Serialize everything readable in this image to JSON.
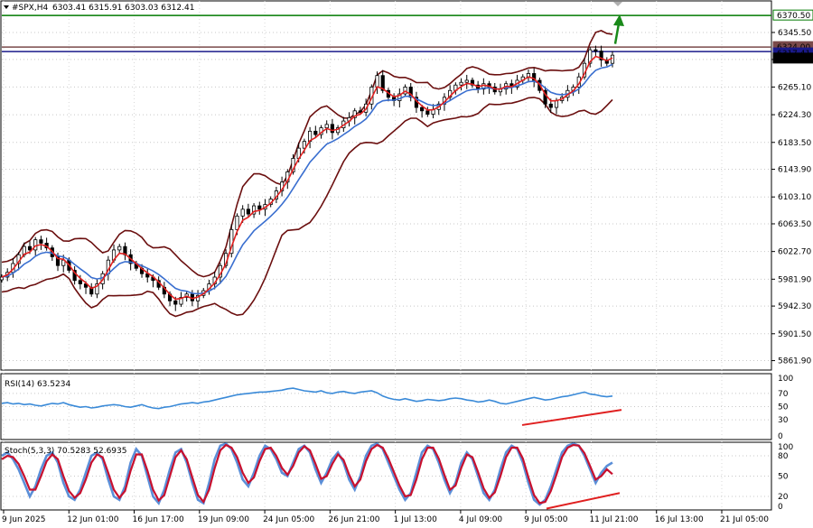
{
  "header": {
    "symbol": "#SPX,H4",
    "ohlc": "6303.41 6315.91 6303.03 6312.41"
  },
  "chart_data": [
    {
      "type": "candlestick",
      "name": "price",
      "ylim": [
        5848,
        6392
      ],
      "y_ticks": [
        "6345.50",
        "6305.70",
        "6265.10",
        "6224.30",
        "6183.50",
        "6143.90",
        "6103.10",
        "6063.50",
        "6022.70",
        "5981.90",
        "5942.30",
        "5901.50",
        "5861.90"
      ],
      "price_tags": [
        {
          "label": "6370.50",
          "value": 6370.5,
          "color": "#007a00",
          "text_color": "#000000"
        },
        {
          "label": "6324.00",
          "value": 6324.0,
          "color": "#7a4a4a",
          "text_color": "#ffffff"
        },
        {
          "label": "6317.41",
          "value": 6317.4,
          "color": "#1a1a8a",
          "text_color": "#ffffff"
        },
        {
          "label": "6312.41",
          "value": 6312.4,
          "color": "#000000",
          "text_color": "#ffffff"
        }
      ],
      "levels": [
        {
          "value": 6370.5,
          "color": "#007a00"
        },
        {
          "value": 6324.0,
          "color": "#7a4a4a"
        },
        {
          "value": 6317.4,
          "color": "#1a1a8a"
        }
      ],
      "close_series": [
        5985,
        5992,
        6005,
        6018,
        6030,
        6025,
        6040,
        6035,
        6028,
        6015,
        6002,
        6010,
        5995,
        5980,
        5975,
        5970,
        5960,
        5975,
        5990,
        6010,
        6025,
        6030,
        6018,
        6005,
        5998,
        5990,
        5985,
        5980,
        5970,
        5960,
        5950,
        5945,
        5955,
        5960,
        5950,
        5958,
        5965,
        5975,
        5985,
        6002,
        6020,
        6055,
        6075,
        6085,
        6078,
        6090,
        6085,
        6092,
        6100,
        6112,
        6125,
        6140,
        6160,
        6175,
        6185,
        6200,
        6195,
        6205,
        6210,
        6198,
        6205,
        6215,
        6220,
        6230,
        6228,
        6240,
        6265,
        6282,
        6260,
        6250,
        6245,
        6255,
        6265,
        6250,
        6235,
        6230,
        6225,
        6232,
        6240,
        6250,
        6260,
        6268,
        6272,
        6275,
        6268,
        6262,
        6270,
        6265,
        6258,
        6262,
        6270,
        6265,
        6275,
        6280,
        6285,
        6275,
        6260,
        6240,
        6235,
        6245,
        6250,
        6260,
        6265,
        6280,
        6300,
        6320,
        6318,
        6305,
        6300,
        6312
      ],
      "colors": {
        "candle": "#000000",
        "bb_outer": "#6b0f0f",
        "bb_mid": "#6b0f0f",
        "ema_fast": "#e02020",
        "ema_slow": "#3a6fd0"
      },
      "annotation": {
        "type": "arrow-up",
        "color": "#1a8a1a"
      }
    },
    {
      "type": "line",
      "name": "RSI(14)",
      "label": "RSI(14) 63.5234",
      "ylim": [
        0,
        100
      ],
      "y_ticks": [
        "100",
        "70",
        "50",
        "30",
        "0"
      ],
      "series": [
        {
          "values": [
            55,
            56,
            54,
            55,
            53,
            54,
            52,
            51,
            53,
            55,
            54,
            56,
            53,
            51,
            49,
            50,
            48,
            49,
            51,
            52,
            53,
            52,
            50,
            49,
            51,
            53,
            50,
            48,
            47,
            49,
            50,
            52,
            54,
            55,
            56,
            55,
            57,
            58,
            60,
            62,
            64,
            66,
            68,
            69,
            70,
            71,
            72,
            72,
            73,
            74,
            75,
            77,
            78,
            76,
            74,
            73,
            72,
            74,
            71,
            70,
            72,
            73,
            71,
            70,
            72,
            73,
            74,
            71,
            66,
            63,
            61,
            60,
            62,
            60,
            58,
            59,
            61,
            60,
            59,
            60,
            62,
            63,
            62,
            60,
            59,
            57,
            58,
            60,
            58,
            55,
            54,
            56,
            58,
            60,
            62,
            64,
            62,
            60,
            61,
            63,
            65,
            66,
            68,
            70,
            72,
            69,
            68,
            66,
            65,
            66
          ]
        }
      ],
      "trendline_color": "#e02020"
    },
    {
      "type": "line",
      "name": "Stoch(5,3,3)",
      "label": "Stoch(5,3,3) 70.5283 52.6935",
      "ylim": [
        0,
        100
      ],
      "y_ticks": [
        "100",
        "80",
        "50",
        "20",
        "0"
      ],
      "series": [
        {
          "name": "70.5283",
          "values": [
            80,
            85,
            75,
            60,
            40,
            20,
            35,
            60,
            80,
            85,
            70,
            40,
            20,
            15,
            30,
            55,
            80,
            85,
            75,
            45,
            20,
            15,
            35,
            70,
            90,
            80,
            50,
            20,
            10,
            30,
            60,
            85,
            90,
            70,
            40,
            15,
            10,
            40,
            75,
            95,
            98,
            90,
            70,
            45,
            35,
            55,
            80,
            95,
            90,
            75,
            55,
            50,
            70,
            90,
            95,
            85,
            60,
            40,
            55,
            75,
            85,
            70,
            45,
            30,
            50,
            80,
            95,
            98,
            90,
            70,
            50,
            30,
            15,
            25,
            55,
            85,
            95,
            90,
            70,
            45,
            25,
            40,
            70,
            85,
            75,
            50,
            25,
            15,
            30,
            60,
            85,
            95,
            90,
            70,
            40,
            15,
            8,
            15,
            35,
            60,
            85,
            95,
            98,
            95,
            80,
            60,
            40,
            55,
            65,
            70
          ]
        },
        {
          "name": "52.6935",
          "values": [
            75,
            80,
            78,
            68,
            50,
            30,
            30,
            50,
            72,
            82,
            75,
            50,
            28,
            18,
            25,
            45,
            70,
            82,
            78,
            55,
            30,
            18,
            28,
            58,
            82,
            82,
            58,
            30,
            14,
            22,
            50,
            78,
            88,
            75,
            48,
            22,
            12,
            30,
            62,
            88,
            96,
            92,
            78,
            55,
            40,
            48,
            72,
            90,
            92,
            80,
            62,
            52,
            65,
            85,
            94,
            88,
            68,
            46,
            50,
            68,
            82,
            74,
            52,
            35,
            45,
            72,
            90,
            96,
            92,
            76,
            56,
            36,
            20,
            22,
            45,
            75,
            92,
            92,
            76,
            52,
            30,
            36,
            62,
            82,
            78,
            56,
            32,
            18,
            26,
            50,
            78,
            92,
            92,
            76,
            48,
            22,
            10,
            12,
            28,
            52,
            78,
            92,
            96,
            95,
            84,
            65,
            45,
            50,
            60,
            53
          ]
        }
      ],
      "colors": [
        "#5b8fd8",
        "#c8102e"
      ],
      "trendline_color": "#e02020"
    }
  ],
  "time_axis": [
    "9 Jun 2025",
    "12 Jun 01:00",
    "16 Jun 17:00",
    "19 Jun 09:00",
    "24 Jun 05:00",
    "26 Jun 21:00",
    "1 Jul 13:00",
    "4 Jul 09:00",
    "9 Jul 05:00",
    "11 Jul 21:00",
    "16 Jul 13:00",
    "21 Jul 05:00"
  ]
}
